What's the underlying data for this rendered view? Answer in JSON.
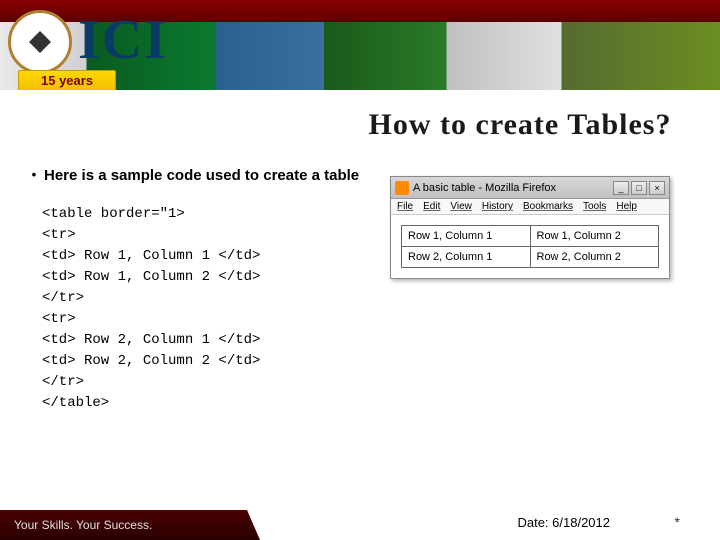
{
  "banner": {
    "logo_text": "ICI",
    "ribbon_text": "15 years"
  },
  "title": "How to create Tables?",
  "bullet": {
    "text": "Here is a sample code used to create a table"
  },
  "code_lines": {
    "l0": "<table border=\"1>",
    "l1": "<tr>",
    "l2": "<td> Row 1, Column 1 </td>",
    "l3": "<td> Row 1, Column 2 </td>",
    "l4": "</tr>",
    "l5": "<tr>",
    "l6": "<td> Row 2, Column 1 </td>",
    "l7": "<td> Row 2, Column 2 </td>",
    "l8": "</tr>",
    "l9": "</table>"
  },
  "window": {
    "title": "A basic table - Mozilla Firefox",
    "menu": {
      "m0": "File",
      "m1": "Edit",
      "m2": "View",
      "m3": "History",
      "m4": "Bookmarks",
      "m5": "Tools",
      "m6": "Help"
    },
    "table": {
      "r1c1": "Row 1, Column 1",
      "r1c2": "Row 1, Column 2",
      "r2c1": "Row 2, Column 1",
      "r2c2": "Row 2, Column 2"
    }
  },
  "footer": {
    "tagline": "Your Skills. Your Success.",
    "date_label": "Date: 6/18/2012",
    "marker": "*"
  }
}
